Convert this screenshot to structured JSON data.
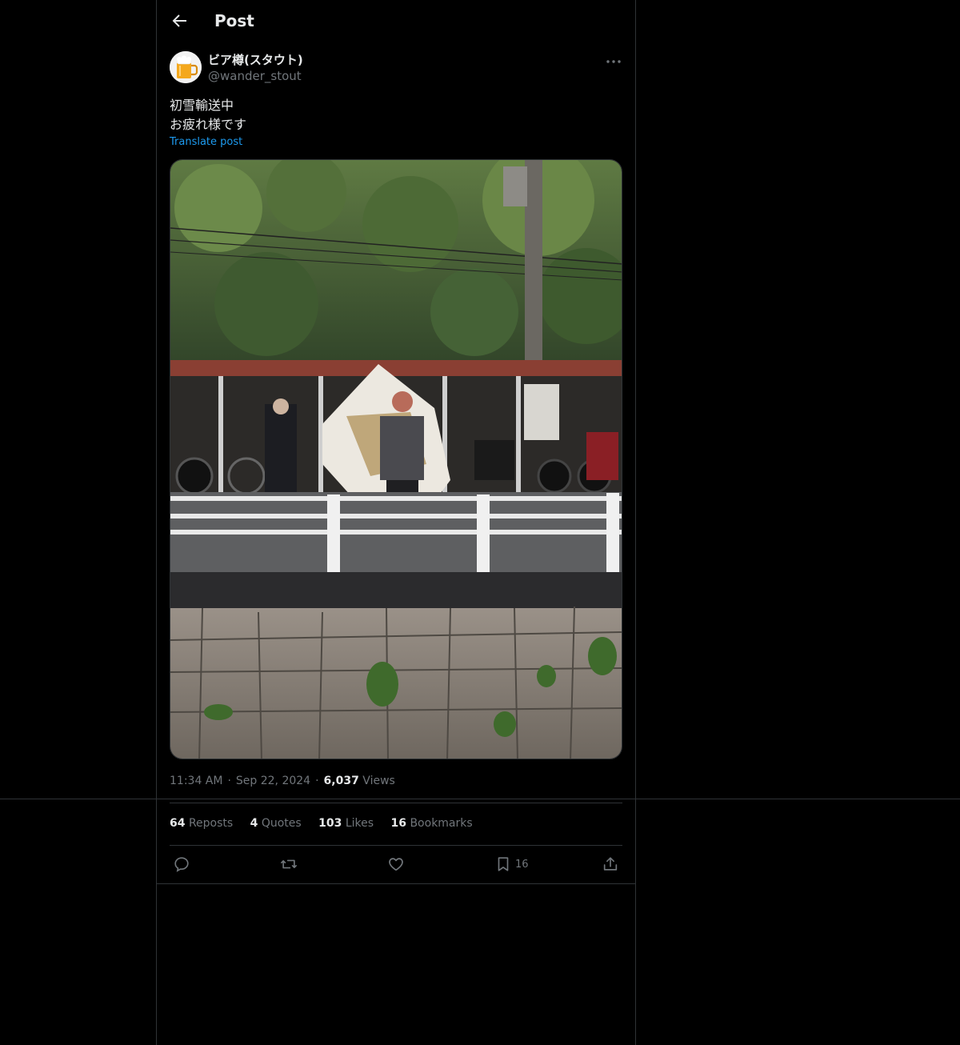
{
  "header": {
    "title": "Post",
    "back_icon": "arrow-left-icon"
  },
  "author": {
    "display_name": "ビア樽(スタウト)",
    "handle": "@wander_stout",
    "avatar_icon": "beer-mug-icon"
  },
  "post": {
    "text": "初雪輸送中\nお疲れ様です",
    "translate_label": "Translate post",
    "media_description": "photo"
  },
  "meta": {
    "time": "11:34 AM",
    "date": "Sep 22, 2024",
    "views_count": "6,037",
    "views_label": "Views"
  },
  "stats": [
    {
      "count": "64",
      "label": "Reposts"
    },
    {
      "count": "4",
      "label": "Quotes"
    },
    {
      "count": "103",
      "label": "Likes"
    },
    {
      "count": "16",
      "label": "Bookmarks"
    }
  ],
  "actions": {
    "reply_icon": "reply-icon",
    "repost_icon": "repost-icon",
    "like_icon": "heart-icon",
    "bookmark_icon": "bookmark-icon",
    "bookmark_count": "16",
    "share_icon": "share-icon"
  },
  "colors": {
    "background": "#000000",
    "text": "#e7e9ea",
    "muted": "#71767b",
    "link": "#1d9bf0",
    "border": "#2f3336"
  }
}
